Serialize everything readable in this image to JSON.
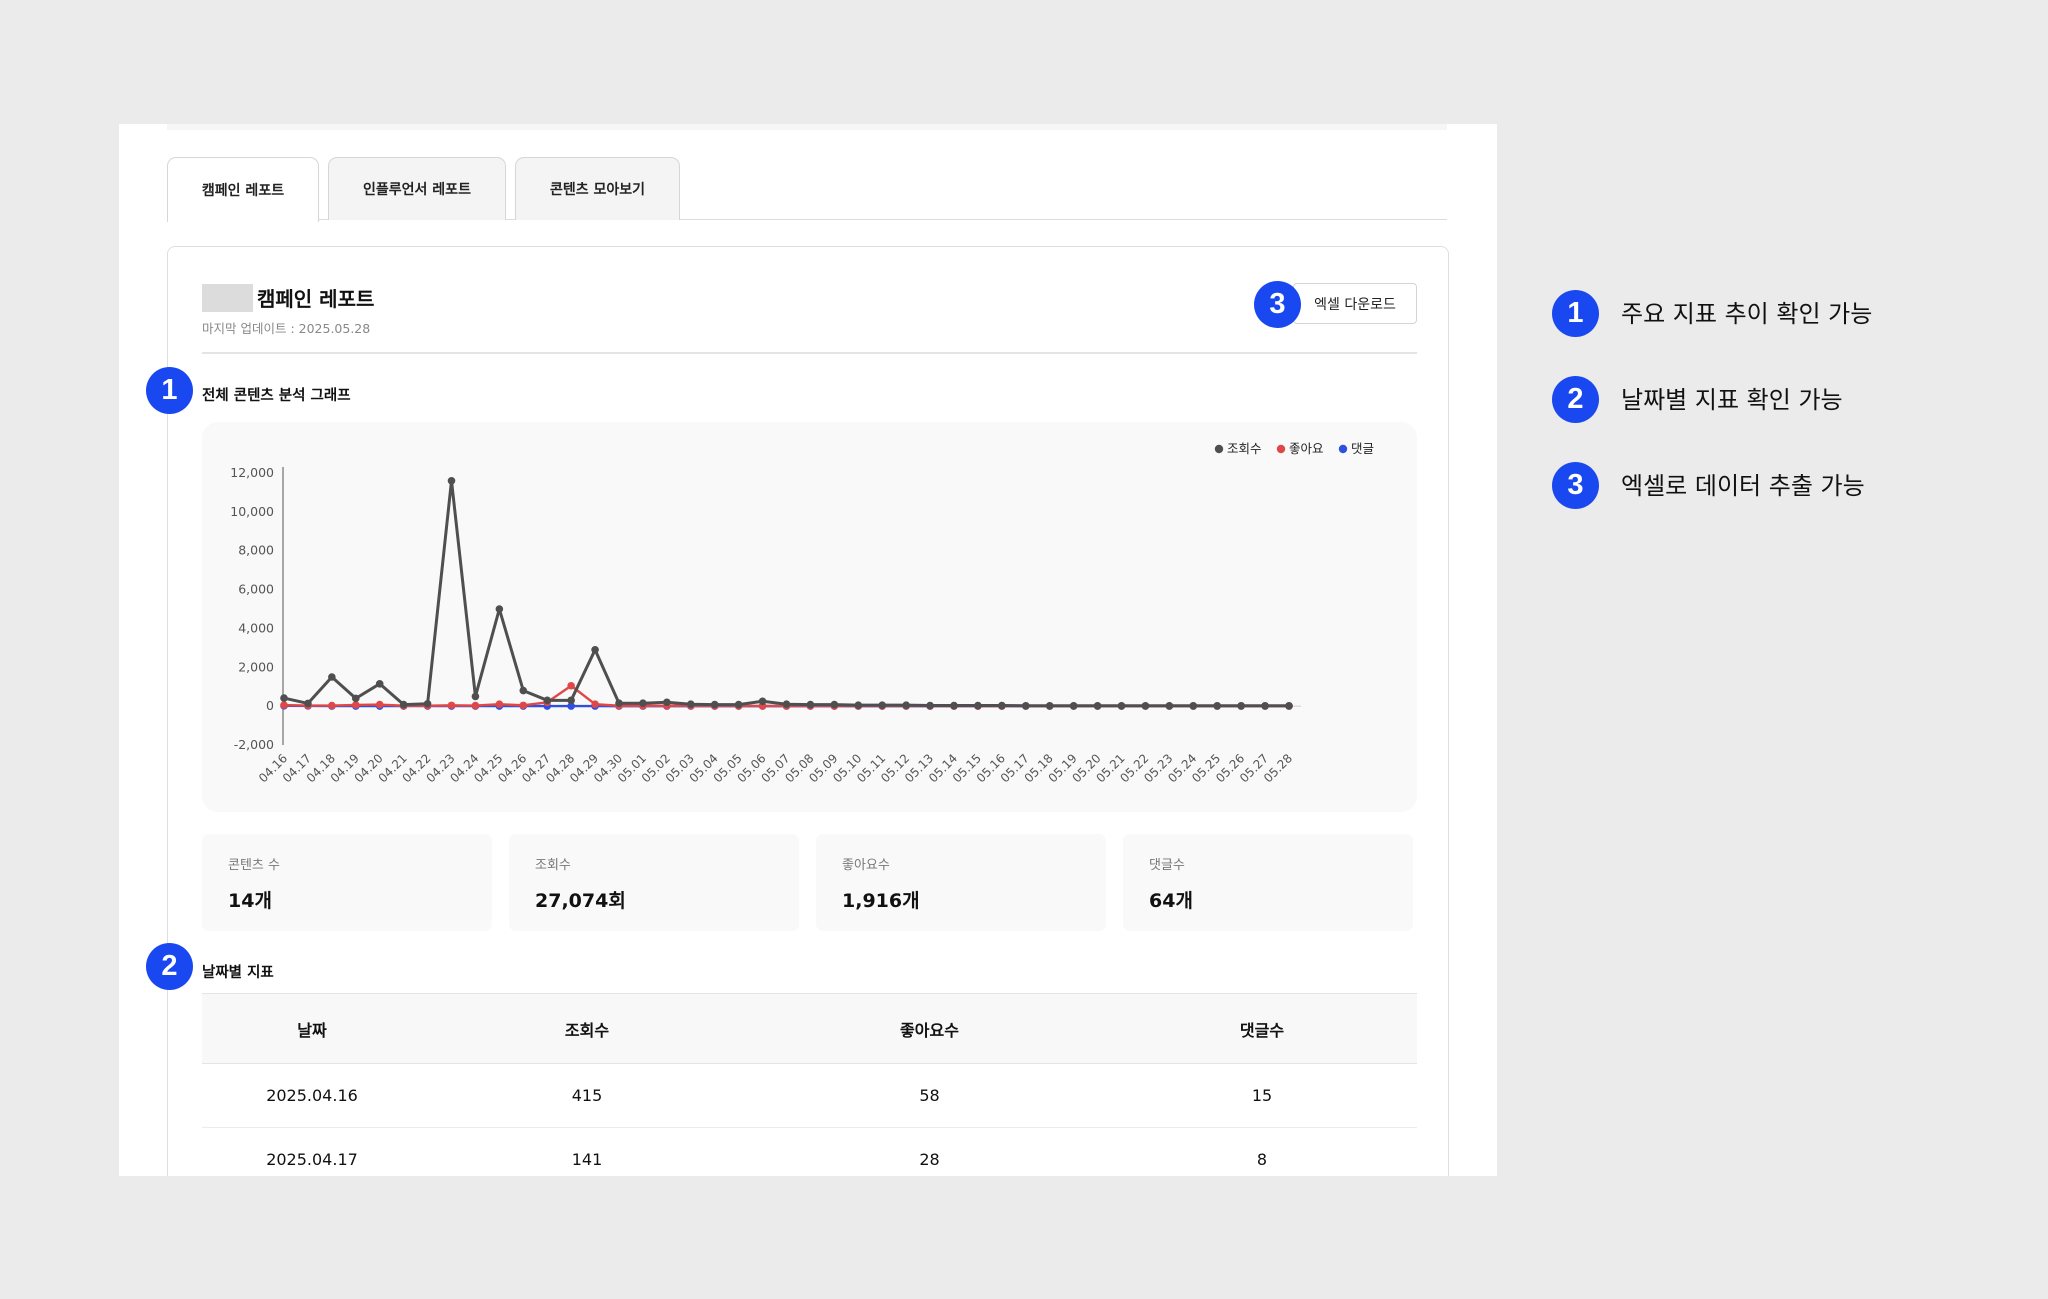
{
  "tabs": [
    "캠페인 레포트",
    "인플루언서 레포트",
    "콘텐츠 모아보기"
  ],
  "report": {
    "title": "캠페인 레포트",
    "update_label": "마지막 업데이트 : ",
    "update_date": "2025.05.28",
    "excel_button": "엑셀 다운로드"
  },
  "graph_section": {
    "title": "전체 콘텐츠 분석 그래프",
    "legend": [
      "조회수",
      "좋아요",
      "댓글"
    ]
  },
  "colors": {
    "views": "#4f4f4f",
    "likes": "#e04848",
    "comments": "#2f4fe0",
    "badge": "#1a48f0"
  },
  "chart_data": {
    "type": "line",
    "categories": [
      "04.16",
      "04.17",
      "04.18",
      "04.19",
      "04.20",
      "04.21",
      "04.22",
      "04.23",
      "04.24",
      "04.25",
      "04.26",
      "04.27",
      "04.28",
      "04.29",
      "04.30",
      "05.01",
      "05.02",
      "05.03",
      "05.04",
      "05.05",
      "05.06",
      "05.07",
      "05.08",
      "05.09",
      "05.10",
      "05.11",
      "05.12",
      "05.13",
      "05.14",
      "05.15",
      "05.16",
      "05.17",
      "05.18",
      "05.19",
      "05.20",
      "05.21",
      "05.22",
      "05.23",
      "05.24",
      "05.25",
      "05.26",
      "05.27",
      "05.28"
    ],
    "series": [
      {
        "name": "조회수",
        "values": [
          415,
          141,
          1500,
          400,
          1150,
          80,
          120,
          11600,
          500,
          5000,
          800,
          300,
          300,
          2900,
          150,
          150,
          200,
          100,
          80,
          80,
          250,
          100,
          80,
          80,
          50,
          50,
          50,
          30,
          30,
          30,
          30,
          20,
          20,
          20,
          20,
          20,
          20,
          20,
          20,
          20,
          20,
          20,
          20
        ]
      },
      {
        "name": "좋아요",
        "values": [
          58,
          28,
          30,
          60,
          80,
          20,
          20,
          40,
          30,
          100,
          40,
          200,
          1050,
          100,
          20,
          20,
          20,
          20,
          10,
          10,
          10,
          10,
          10,
          10,
          10,
          10,
          10,
          5,
          5,
          5,
          5,
          5,
          5,
          5,
          5,
          5,
          5,
          5,
          5,
          5,
          5,
          5,
          5
        ]
      },
      {
        "name": "댓글",
        "values": [
          15,
          8,
          5,
          5,
          5,
          2,
          2,
          5,
          3,
          5,
          3,
          2,
          2,
          2,
          1,
          1,
          1,
          1,
          1,
          1,
          1,
          1,
          1,
          1,
          1,
          1,
          1,
          1,
          1,
          1,
          1,
          1,
          1,
          1,
          1,
          1,
          1,
          1,
          1,
          1,
          1,
          1,
          1
        ]
      }
    ],
    "y_ticks": [
      "12,000",
      "10,000",
      "8,000",
      "6,000",
      "4,000",
      "2,000",
      "0",
      "-2,000"
    ],
    "ylim": [
      -2000,
      12000
    ],
    "legend_position": "top-right",
    "grid": false
  },
  "stats": [
    {
      "label": "콘텐츠 수",
      "value": "14개"
    },
    {
      "label": "조회수",
      "value": "27,074회"
    },
    {
      "label": "좋아요수",
      "value": "1,916개"
    },
    {
      "label": "댓글수",
      "value": "64개"
    }
  ],
  "daily_section": {
    "title": "날짜별 지표",
    "headers": [
      "날짜",
      "조회수",
      "좋아요수",
      "댓글수"
    ],
    "rows": [
      [
        "2025.04.16",
        "415",
        "58",
        "15"
      ],
      [
        "2025.04.17",
        "141",
        "28",
        "8"
      ]
    ]
  },
  "badges": [
    "1",
    "2",
    "3"
  ],
  "side_notes": [
    "주요 지표 추이 확인 가능",
    "날짜별 지표 확인 가능",
    "엑셀로 데이터 추출 가능"
  ]
}
